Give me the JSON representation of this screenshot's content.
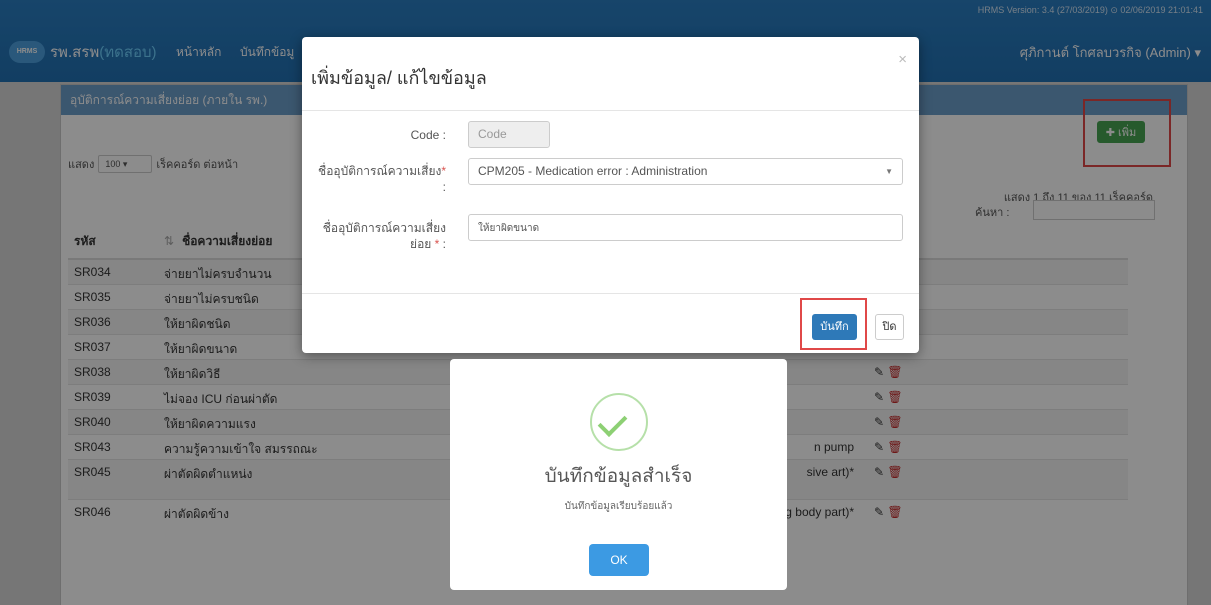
{
  "header": {
    "version": "HRMS Version: 3.4 (27/03/2019) ⊙ 02/06/2019 21:01:41",
    "logo": "HRMS",
    "hospital_name": "รพ.สรพ",
    "hospital_suffix": "(ทดสอบ)",
    "nav_home": "หน้าหลัก",
    "nav_record": "บันทึกข้อมู",
    "user": "ศุภิกานต์ โกศลบวรกิจ (Admin) ▾"
  },
  "panel": {
    "title": "อุบัติการณ์ความเสี่ยงย่อย (ภายใน รพ.)",
    "show_label": "แสดง",
    "page_size": "100",
    "records_per_page": "เร็คคอร์ด ต่อหน้า",
    "add_label": "เพิ่ม",
    "info": "แสดง 1 ถึง 11 ของ 11 เร็คคอร์ด",
    "search_label": "ค้นหา :",
    "col_code": "รหัส",
    "col_name": "ชื่อความเสี่ยงย่อย",
    "rows": [
      {
        "code": "SR034",
        "name": "จ่ายยาไม่ครบจำนวน",
        "main": ""
      },
      {
        "code": "SR035",
        "name": "จ่ายยาไม่ครบชนิด",
        "main": ""
      },
      {
        "code": "SR036",
        "name": "ให้ยาผิดชนิด",
        "main": ""
      },
      {
        "code": "SR037",
        "name": "ให้ยาผิดขนาด",
        "main": ""
      },
      {
        "code": "SR038",
        "name": "ให้ยาผิดวิธี",
        "main": ""
      },
      {
        "code": "SR039",
        "name": "ไม่จอง ICU ก่อนผ่าตัด",
        "main": ""
      },
      {
        "code": "SR040",
        "name": "ให้ยาผิดความแรง",
        "main": ""
      },
      {
        "code": "SR043",
        "name": "ความรู้ความเข้าใจ สมรรถณะ",
        "main": "n pump"
      },
      {
        "code": "SR045",
        "name": "ผ่าตัดผิดตำแหน่ง",
        "main": "sive art)*"
      },
      {
        "code": "SR046",
        "name": "ผ่าตัดผิดข้าง",
        "main": "sive procedure performed on the wrong body part)*"
      }
    ]
  },
  "modal": {
    "title": "เพิ่มข้อมูล/ แก้ไขข้อมูล",
    "close_x": "×",
    "code_label": "Code :",
    "code_placeholder": "Code",
    "risk_label": "ชื่ออุบัติการณ์ความเสี่ยง",
    "risk_value": "CPM205 - Medication error : Administration",
    "sub_label_1": "ชื่ออุบัติการณ์ความเสี่ยง",
    "sub_label_2": "ย่อย",
    "sub_value": "ให้ยาผิดขนาด",
    "save": "บันทึก",
    "close": "ปิด"
  },
  "alert": {
    "title": "บันทึกข้อมูลสำเร็จ",
    "text": "บันทึกข้อมูลเรียบร้อยแล้ว",
    "ok": "OK"
  },
  "colors": {
    "nav": "#2271b3",
    "panel_header": "#6c9ecb",
    "add_button": "#48a453",
    "save_button": "#2e79b8",
    "ok_button": "#3c9ae3",
    "highlight": "#e04848",
    "success": "#8dd074"
  }
}
